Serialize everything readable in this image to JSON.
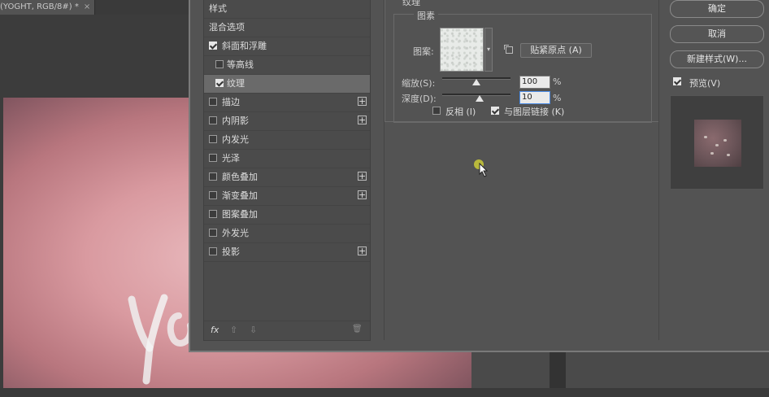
{
  "document": {
    "tab_title": "(YOGHT, RGB/8#) *",
    "tab_close": "×"
  },
  "dialog": {
    "styles_list": {
      "items": [
        {
          "label": "样式",
          "checkbox": false,
          "checked": false,
          "plus": false,
          "indent": false,
          "selected": false
        },
        {
          "label": "混合选项",
          "checkbox": false,
          "checked": false,
          "plus": false,
          "indent": false,
          "selected": false
        },
        {
          "label": "斜面和浮雕",
          "checkbox": true,
          "checked": true,
          "plus": false,
          "indent": false,
          "selected": false
        },
        {
          "label": "等高线",
          "checkbox": true,
          "checked": false,
          "plus": false,
          "indent": true,
          "selected": false
        },
        {
          "label": "纹理",
          "checkbox": true,
          "checked": true,
          "plus": false,
          "indent": true,
          "selected": true
        },
        {
          "label": "描边",
          "checkbox": true,
          "checked": false,
          "plus": true,
          "indent": false,
          "selected": false
        },
        {
          "label": "内阴影",
          "checkbox": true,
          "checked": false,
          "plus": true,
          "indent": false,
          "selected": false
        },
        {
          "label": "内发光",
          "checkbox": true,
          "checked": false,
          "plus": false,
          "indent": false,
          "selected": false
        },
        {
          "label": "光泽",
          "checkbox": true,
          "checked": false,
          "plus": false,
          "indent": false,
          "selected": false
        },
        {
          "label": "颜色叠加",
          "checkbox": true,
          "checked": false,
          "plus": true,
          "indent": false,
          "selected": false
        },
        {
          "label": "渐变叠加",
          "checkbox": true,
          "checked": false,
          "plus": true,
          "indent": false,
          "selected": false
        },
        {
          "label": "图案叠加",
          "checkbox": true,
          "checked": false,
          "plus": false,
          "indent": false,
          "selected": false
        },
        {
          "label": "外发光",
          "checkbox": true,
          "checked": false,
          "plus": false,
          "indent": false,
          "selected": false
        },
        {
          "label": "投影",
          "checkbox": true,
          "checked": false,
          "plus": true,
          "indent": false,
          "selected": false
        }
      ],
      "footer": {
        "fx": "fx",
        "up": "⇧",
        "down": "⇩",
        "trash": "🗑"
      }
    },
    "texture": {
      "title": "纹理",
      "elements_title": "图素",
      "pattern_label": "图案:",
      "snap_label": "贴紧原点 (A)",
      "scale_label": "缩放(S):",
      "scale_value": "100",
      "scale_level": 0.5,
      "depth_label": "深度(D):",
      "depth_value": "10",
      "depth_level": 0.55,
      "percent": "%",
      "invert_label": "反相 (I)",
      "invert_checked": false,
      "link_label": "与图层链接 (K)",
      "link_checked": true
    },
    "buttons": {
      "ok": "确定",
      "cancel": "取消",
      "new_style": "新建样式(W)...",
      "preview_label": "预览(V)",
      "preview_checked": true
    }
  },
  "colors": {
    "dialog_bg": "#535353",
    "list_selected": "#6a6a6a",
    "canvas_pink": "#d99aa0",
    "cursor_highlight": "#c4c43a"
  }
}
